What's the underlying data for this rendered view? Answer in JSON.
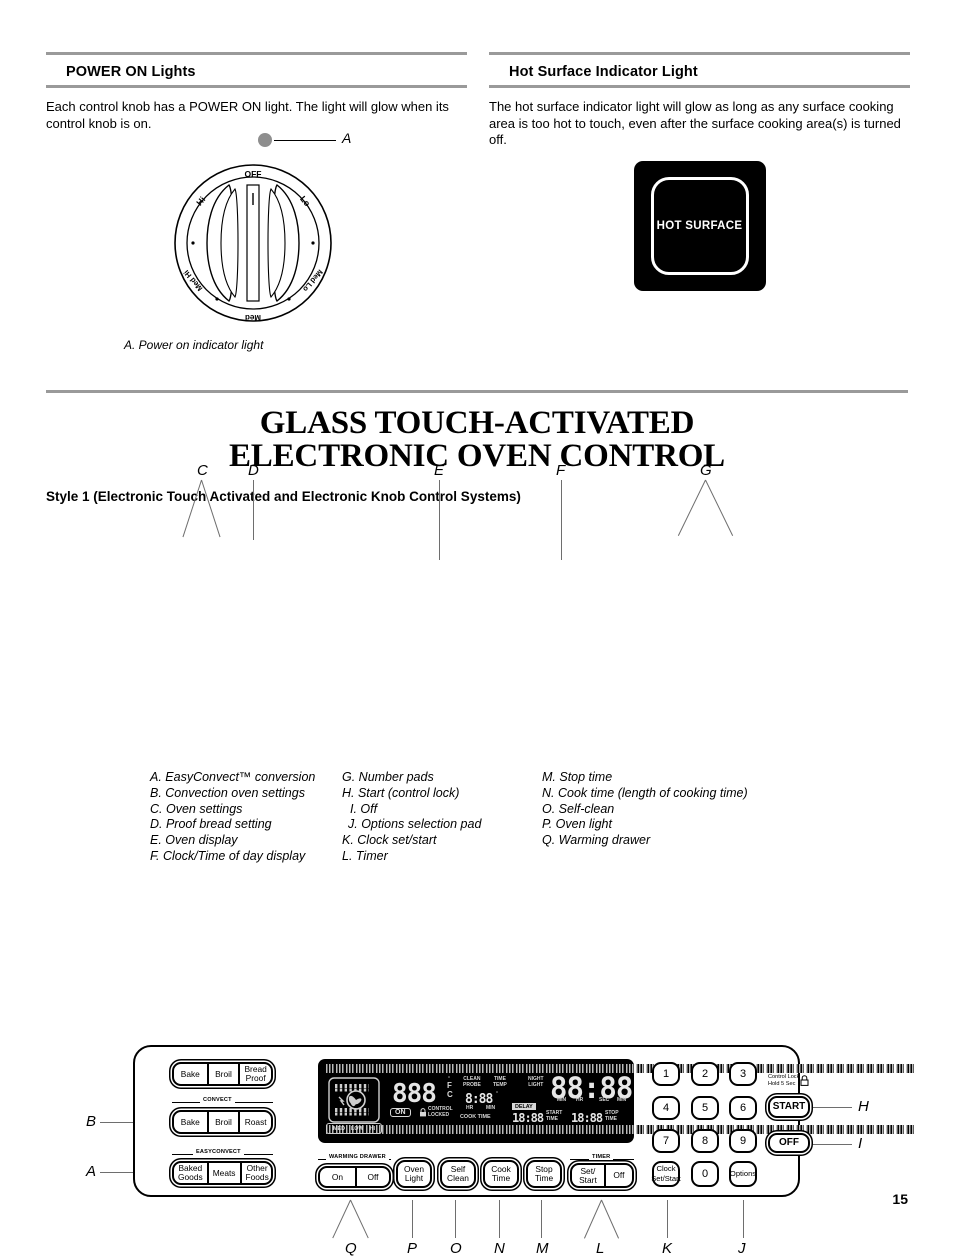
{
  "sections": {
    "power_on": {
      "heading": "POWER ON Lights",
      "body": "Each control knob has a POWER ON light. The light will glow when its control knob is on.",
      "knob": {
        "off": "OFF",
        "hi": "Hi",
        "lo": "Lo",
        "med_hi": "Med Hi",
        "med_lo": "Med Lo",
        "med": "Med"
      },
      "caption": "A. Power on indicator light",
      "callout": "A"
    },
    "hot_surface": {
      "heading": "Hot Surface Indicator Light",
      "body": "The hot surface indicator light will glow as long as any surface cooking area is too hot to touch, even after the surface cooking area(s) is turned off.",
      "panel_text": "HOT SURFACE"
    }
  },
  "title": {
    "line1": "GLASS TOUCH-ACTIVATED",
    "line2": "ELECTRONIC OVEN CONTROL",
    "style": "Style 1 (Electronic Touch Activated and Electronic Knob Control Systems)"
  },
  "control_panel": {
    "oven_settings": {
      "labels": [
        "Bake",
        "Broil",
        "Bread\nProof"
      ]
    },
    "convect": {
      "group": "CONVECT",
      "labels": [
        "Bake",
        "Broil",
        "Roast"
      ]
    },
    "easyconvect": {
      "group": "EASYCONVECT",
      "labels": [
        "Baked\nGoods",
        "Meats",
        "Other\nFoods"
      ]
    },
    "warming_drawer": {
      "group": "WARMING DRAWER",
      "labels": [
        "On",
        "Off"
      ]
    },
    "function_keys": [
      "Oven\nLight",
      "Self\nClean",
      "Cook\nTime",
      "Stop\nTime"
    ],
    "timer": {
      "group": "TIMER",
      "labels": [
        "Set/\nStart",
        "Off"
      ]
    },
    "keypad": [
      "1",
      "2",
      "3",
      "4",
      "5",
      "6",
      "7",
      "8",
      "9",
      "Clock\nSet/Start",
      "0",
      "Options"
    ],
    "start_button": "START",
    "off_button": "OFF",
    "control_lock": {
      "line1": "Control Lock",
      "line2": "Hold 5 Sec",
      "icon": "lock-icon"
    },
    "display": {
      "temp": "888",
      "unit_f": "F",
      "unit_c": "C",
      "degree": "°",
      "on_badge": "ON",
      "control_locked": "CONTROL\nLOCKED",
      "fan_levels": [
        "MED",
        "LOW",
        "HI"
      ],
      "clean_probe": "CLEAN\nPROBE",
      "time_temp": "TIME\nTEMP",
      "night_light": "NIGHT\nLIGHT",
      "cook_time_value": "8:88",
      "hr": "HR",
      "min": "MIN",
      "cook_time_label": "COOK  TIME",
      "clock_value": "88:88",
      "clock_units": [
        "MIN",
        "HR",
        "SEC",
        "MIN"
      ],
      "delay_badge": "DELAY",
      "start_time_value": "18:88",
      "start_time_label": "START\nTIME",
      "stop_time_value": "18:88",
      "stop_time_label": "STOP\nTIME"
    }
  },
  "callouts": {
    "top": [
      "C",
      "D",
      "E",
      "F",
      "G"
    ],
    "left": [
      "B",
      "A"
    ],
    "right": [
      "H",
      "I"
    ],
    "bottom": [
      "Q",
      "P",
      "O",
      "N",
      "M",
      "L",
      "K",
      "J"
    ]
  },
  "legend": {
    "col1": [
      "A. EasyConvect™ conversion",
      "B. Convection oven settings",
      "C. Oven settings",
      "D. Proof bread setting",
      "E. Oven display",
      "F. Clock/Time of day display"
    ],
    "col2": [
      "G. Number pads",
      "H. Start (control lock)",
      "I. Off",
      "J. Options selection pad",
      "K. Clock set/start",
      "L. Timer"
    ],
    "col3": [
      "M. Stop time",
      "N. Cook time (length of cooking time)",
      "O. Self-clean",
      "P. Oven light",
      "Q. Warming drawer"
    ]
  },
  "page_number": "15"
}
